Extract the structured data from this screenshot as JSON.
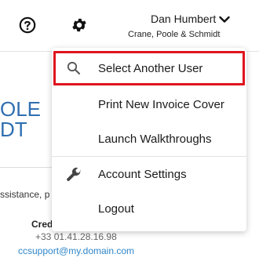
{
  "header": {
    "user_name": "Dan Humbert",
    "company": "Crane, Poole & Schmidt",
    "icons": [
      "help-icon",
      "gear-icon",
      "chevron-down-icon"
    ]
  },
  "background": {
    "logo_line1": "OLE",
    "logo_line2": "DT",
    "assistance_text": "ssistance, p",
    "cred_label": "Cred",
    "phone": "+33 01.41.28.16.98",
    "email": "ccsupport@my.domain.com"
  },
  "menu": {
    "items": [
      {
        "label": "Select Another User",
        "icon": "search-icon",
        "highlighted": true
      },
      {
        "label": "Print New Invoice Cover"
      },
      {
        "label": "Launch Walkthroughs"
      },
      {
        "label": "Account Settings",
        "icon": "wrench-icon"
      },
      {
        "label": "Logout"
      }
    ]
  },
  "colors": {
    "highlight_border": "#e0141e",
    "logo_blue": "#2f6fb0",
    "link_blue": "#2f86c9"
  }
}
